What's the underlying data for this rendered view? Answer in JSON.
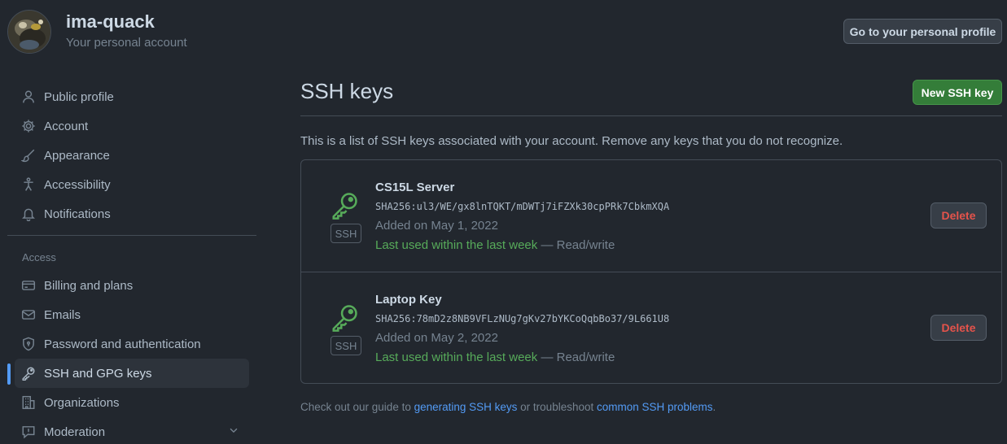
{
  "header": {
    "username": "ima-quack",
    "subtitle": "Your personal account",
    "profile_button": "Go to your personal profile"
  },
  "sidebar": {
    "items": [
      {
        "label": "Public profile",
        "icon": "person-icon"
      },
      {
        "label": "Account",
        "icon": "gear-icon"
      },
      {
        "label": "Appearance",
        "icon": "paintbrush-icon"
      },
      {
        "label": "Accessibility",
        "icon": "accessibility-icon"
      },
      {
        "label": "Notifications",
        "icon": "bell-icon"
      }
    ],
    "access_label": "Access",
    "access_items": [
      {
        "label": "Billing and plans",
        "icon": "credit-card-icon"
      },
      {
        "label": "Emails",
        "icon": "mail-icon"
      },
      {
        "label": "Password and authentication",
        "icon": "shield-lock-icon"
      },
      {
        "label": "SSH and GPG keys",
        "icon": "key-icon",
        "active": true
      },
      {
        "label": "Organizations",
        "icon": "organization-icon"
      },
      {
        "label": "Moderation",
        "icon": "report-icon"
      }
    ]
  },
  "main": {
    "title": "SSH keys",
    "new_button": "New SSH key",
    "intro": "This is a list of SSH keys associated with your account. Remove any keys that you do not recognize.",
    "keys": [
      {
        "title": "CS15L Server",
        "fingerprint": "SHA256:ul3/WE/gx8lnTQKT/mDWTj7iFZXk30cpPRk7CbkmXQA",
        "added": "Added on May 1, 2022",
        "last_used": "Last used within the last week",
        "access": " — Read/write",
        "tag": "SSH",
        "delete": "Delete"
      },
      {
        "title": "Laptop Key",
        "fingerprint": "SHA256:78mD2z8NB9VFLzNUg7gKv27bYKCoQqbBo37/9L661U8",
        "added": "Added on May 2, 2022",
        "last_used": "Last used within the last week",
        "access": " — Read/write",
        "tag": "SSH",
        "delete": "Delete"
      }
    ],
    "footer": {
      "prefix": "Check out our guide to ",
      "link1": "generating SSH keys",
      "middle": " or troubleshoot ",
      "link2": "common SSH problems",
      "suffix": "."
    }
  },
  "colors": {
    "background": "#22272e",
    "accent_green": "#57ab5a",
    "primary_button": "#347d39",
    "danger": "#e5534b",
    "link": "#539bf5",
    "active_indicator": "#539bf5"
  }
}
